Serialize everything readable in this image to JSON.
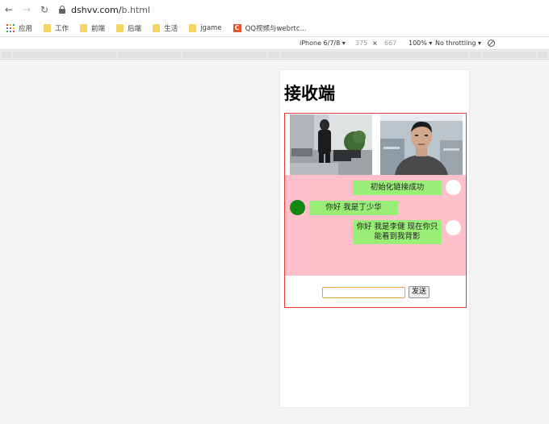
{
  "browser": {
    "url_domain": "dshvv.com/",
    "url_path": "b.html"
  },
  "bookmarks": [
    {
      "label": "应用",
      "icon": "apps-grid-icon"
    },
    {
      "label": "工作",
      "icon": "folder-icon"
    },
    {
      "label": "前端",
      "icon": "folder-icon"
    },
    {
      "label": "后端",
      "icon": "folder-icon"
    },
    {
      "label": "生活",
      "icon": "folder-icon"
    },
    {
      "label": "jgame",
      "icon": "folder-icon"
    },
    {
      "label": "QQ视频与webrtc...",
      "icon": "c-logo-icon"
    }
  ],
  "devtools": {
    "device": "iPhone 6/7/8 ▾",
    "width": "375",
    "times": "×",
    "height": "667",
    "zoom": "100% ▾",
    "throttling": "No throttling ▾"
  },
  "page": {
    "title": "接收端",
    "send_label": "发送",
    "input_value": "",
    "messages": [
      {
        "side": "right",
        "text": "初始化链接成功",
        "avatar_color": "#ffffff"
      },
      {
        "side": "left",
        "text": "你好 我是丁少华",
        "avatar_color": "#118811"
      },
      {
        "side": "right",
        "text": "你好 我是李健 现在你只能看到我背影",
        "avatar_color": "#ffffff"
      }
    ]
  },
  "colors": {
    "chat_bg": "#ffc0cb",
    "bubble": "#99ee77",
    "frame_border": "#e53935",
    "input_focus": "#e8a33c"
  }
}
